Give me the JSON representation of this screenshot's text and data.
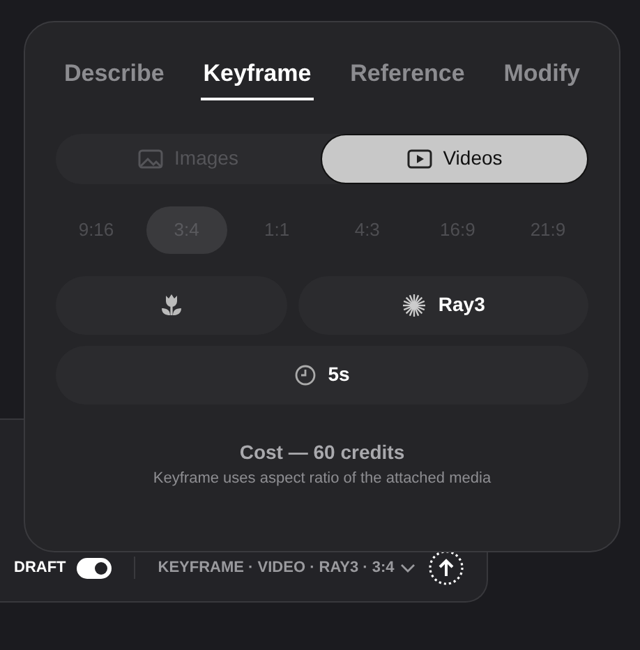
{
  "tabs": [
    {
      "label": "Describe",
      "selected": false
    },
    {
      "label": "Keyframe",
      "selected": true
    },
    {
      "label": "Reference",
      "selected": false
    },
    {
      "label": "Modify",
      "selected": false
    }
  ],
  "media_toggle": [
    {
      "kind": "image",
      "label": "Images",
      "selected": false
    },
    {
      "kind": "video",
      "label": "Videos",
      "selected": true
    }
  ],
  "aspect_ratios": [
    {
      "label": "9:16",
      "selected": false
    },
    {
      "label": "3:4",
      "selected": true
    },
    {
      "label": "1:1",
      "selected": false
    },
    {
      "label": "4:3",
      "selected": false
    },
    {
      "label": "16:9",
      "selected": false
    },
    {
      "label": "21:9",
      "selected": false
    }
  ],
  "options": [
    {
      "kind": "style"
    },
    {
      "kind": "model",
      "label": "Ray3"
    },
    {
      "kind": "duration",
      "label": "5s"
    }
  ],
  "cost": "Cost — 60 credits",
  "note": "Keyframe uses aspect ratio of the attached media",
  "footer": {
    "draft_label": "DRAFT",
    "draft_on": true,
    "summary": "KEYFRAME · VIDEO · RAY3 · 3:4"
  }
}
